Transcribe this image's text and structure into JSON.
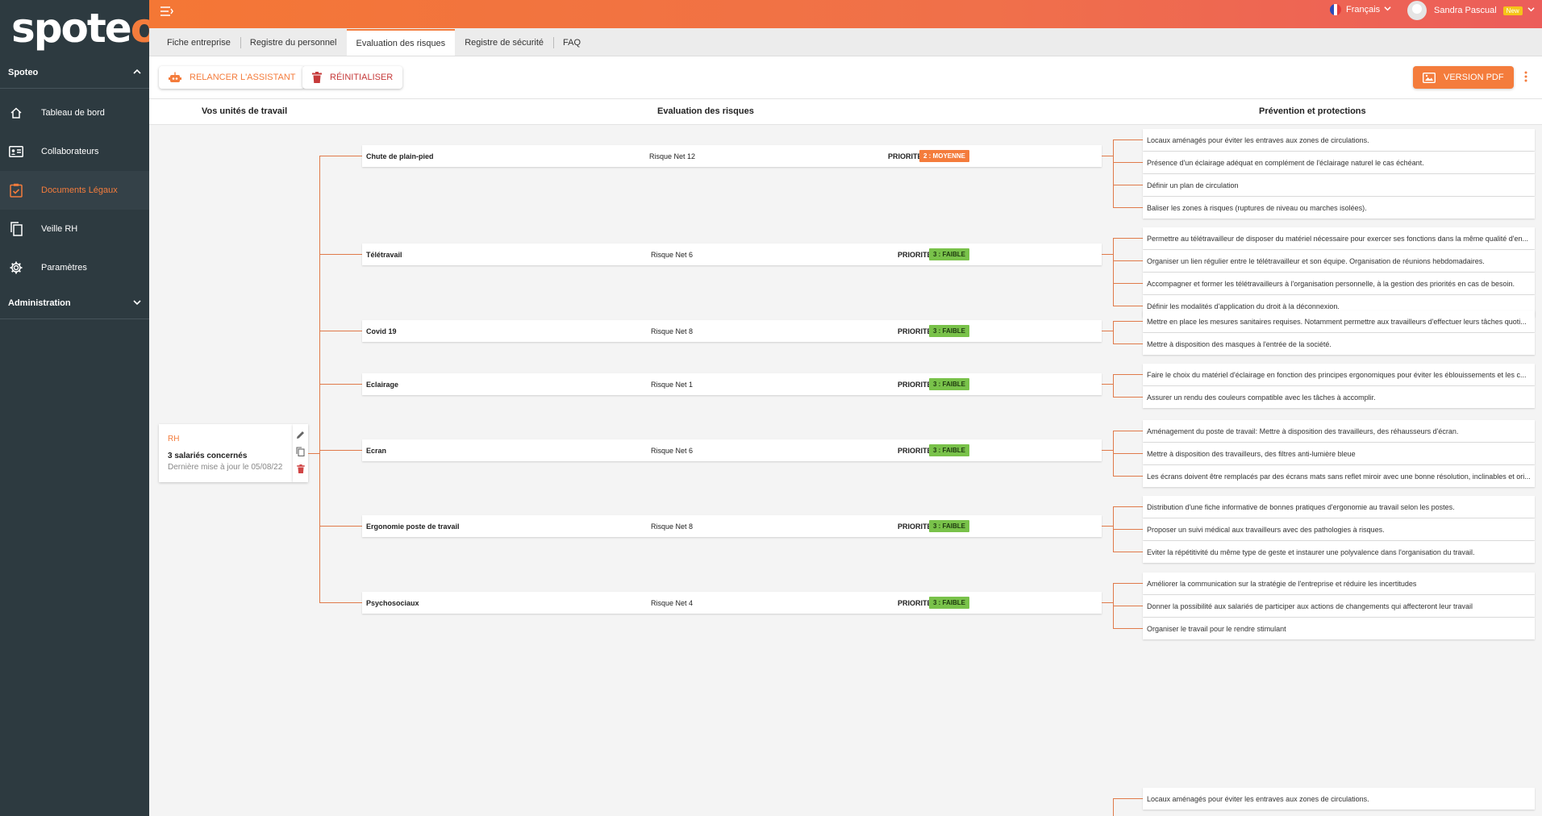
{
  "app": {
    "logo": "spoteo",
    "accent": "#f47c3c"
  },
  "sidebar": {
    "section_spoteo": "Spoteo",
    "items": [
      {
        "label": "Tableau de bord",
        "icon": "home-icon"
      },
      {
        "label": "Collaborateurs",
        "icon": "id-card-icon"
      },
      {
        "label": "Documents Légaux",
        "icon": "clipboard-check-icon",
        "active": true
      },
      {
        "label": "Veille RH",
        "icon": "copy-icon"
      },
      {
        "label": "Paramètres",
        "icon": "gear-icon"
      }
    ],
    "section_admin": "Administration"
  },
  "topbar": {
    "language": "Français",
    "user_name": "Sandra Pascual",
    "new_badge": "New"
  },
  "tabs": [
    {
      "label": "Fiche entreprise"
    },
    {
      "label": "Registre du personnel"
    },
    {
      "label": "Evaluation des risques",
      "active": true
    },
    {
      "label": "Registre de sécurité"
    },
    {
      "label": "FAQ"
    }
  ],
  "toolbar": {
    "relaunch_label": "RELANCER L'ASSISTANT",
    "reset_label": "RÉINITIALISER",
    "pdf_label": "VERSION PDF"
  },
  "columns": {
    "units": "Vos unités de travail",
    "evaluation": "Evaluation des risques",
    "prevention": "Prévention et protections"
  },
  "unit": {
    "title": "RH",
    "count": "3 salariés concernés",
    "updated": "Dernière mise à jour le 05/08/22"
  },
  "priority_label": "PRIORITE",
  "risks": [
    {
      "name": "Chute de plain-pied",
      "net": "Risque Net 12",
      "level": "2 : MOYENNE",
      "level_type": "moyenne",
      "preventions": [
        "Locaux aménagés pour éviter les entraves aux zones de circulations.",
        "Présence d'un éclairage adéquat en complément de l'éclairage naturel le cas échéant.",
        "Définir un plan de circulation",
        "Baliser les zones à risques (ruptures de niveau ou marches isolées)."
      ]
    },
    {
      "name": "Télétravail",
      "net": "Risque Net 6",
      "level": "3 : FAIBLE",
      "level_type": "faible",
      "preventions": [
        "Permettre au télétravailleur de disposer du matériel nécessaire pour exercer ses fonctions dans la même qualité d'en...",
        "Organiser un lien régulier entre le télétravailleur et son équipe. Organisation de réunions hebdomadaires.",
        "Accompagner et former les télétravailleurs à l'organisation personnelle, à la gestion des priorités en cas de besoin.",
        "Définir les modalités d'application du droit à la déconnexion."
      ]
    },
    {
      "name": "Covid 19",
      "net": "Risque Net 8",
      "level": "3 : FAIBLE",
      "level_type": "faible",
      "preventions": [
        "Mettre en place les mesures sanitaires requises. Notamment permettre aux travailleurs d'effectuer leurs tâches quoti...",
        "Mettre à disposition des masques à l'entrée de la société."
      ]
    },
    {
      "name": "Eclairage",
      "net": "Risque Net 1",
      "level": "3 : FAIBLE",
      "level_type": "faible",
      "preventions": [
        "Faire le choix du matériel d'éclairage en fonction des principes ergonomiques pour éviter les éblouissements et les c...",
        "Assurer un rendu des couleurs compatible avec les tâches à accomplir."
      ]
    },
    {
      "name": "Ecran",
      "net": "Risque Net 6",
      "level": "3 : FAIBLE",
      "level_type": "faible",
      "preventions": [
        "Aménagement du poste de travail: Mettre à disposition des travailleurs, des réhausseurs d'écran.",
        "Mettre à disposition des travailleurs, des filtres anti-lumière bleue",
        "Les écrans doivent être remplacés par des écrans mats sans reflet miroir avec une bonne résolution, inclinables et ori..."
      ]
    },
    {
      "name": "Ergonomie poste de travail",
      "net": "Risque Net 8",
      "level": "3 : FAIBLE",
      "level_type": "faible",
      "preventions": [
        "Distribution d'une fiche informative de bonnes pratiques d'ergonomie au travail selon les postes.",
        "Proposer un suivi médical aux travailleurs avec des pathologies à risques.",
        "Eviter la répétitivité du même type de geste et instaurer une polyvalence dans l'organisation du travail."
      ]
    },
    {
      "name": "Psychosociaux",
      "net": "Risque Net 4",
      "level": "3 : FAIBLE",
      "level_type": "faible",
      "preventions": [
        "Améliorer la communication sur la stratégie de l'entreprise et réduire les incertitudes",
        "Donner la possibilité aux salariés de participer aux actions de changements qui affecteront leur travail",
        "Organiser le travail pour le rendre stimulant"
      ]
    }
  ],
  "trailing_prevention": "Locaux aménagés pour éviter les entraves aux zones de circulations."
}
